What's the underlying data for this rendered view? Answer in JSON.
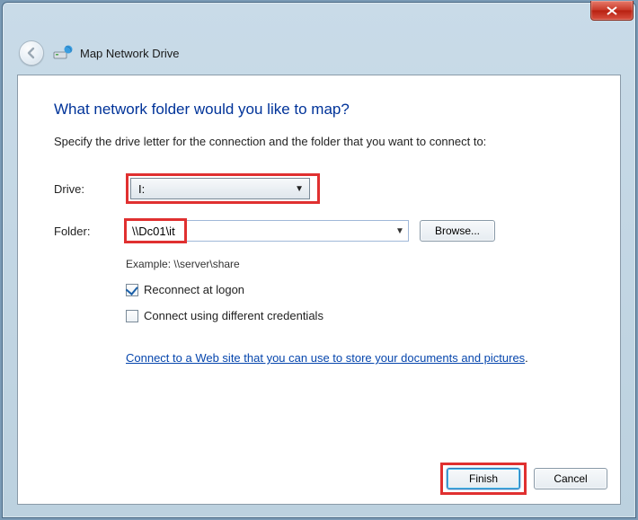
{
  "window": {
    "title": "Map Network Drive"
  },
  "page": {
    "heading": "What network folder would you like to map?",
    "subtext": "Specify the drive letter for the connection and the folder that you want to connect to:"
  },
  "form": {
    "drive_label": "Drive:",
    "drive_value": "I:",
    "folder_label": "Folder:",
    "folder_value": "\\\\Dc01\\it",
    "browse_label": "Browse...",
    "example_text": "Example: \\\\server\\share",
    "reconnect_label": "Reconnect at logon",
    "reconnect_checked": true,
    "credentials_label": "Connect using different credentials",
    "credentials_checked": false,
    "link_text": "Connect to a Web site that you can use to store your documents and pictures",
    "link_period": "."
  },
  "footer": {
    "finish_label": "Finish",
    "cancel_label": "Cancel"
  },
  "icons": {
    "close": "close-icon",
    "back": "back-arrow-icon",
    "network_drive": "network-drive-icon",
    "dropdown": "chevron-down-icon"
  }
}
